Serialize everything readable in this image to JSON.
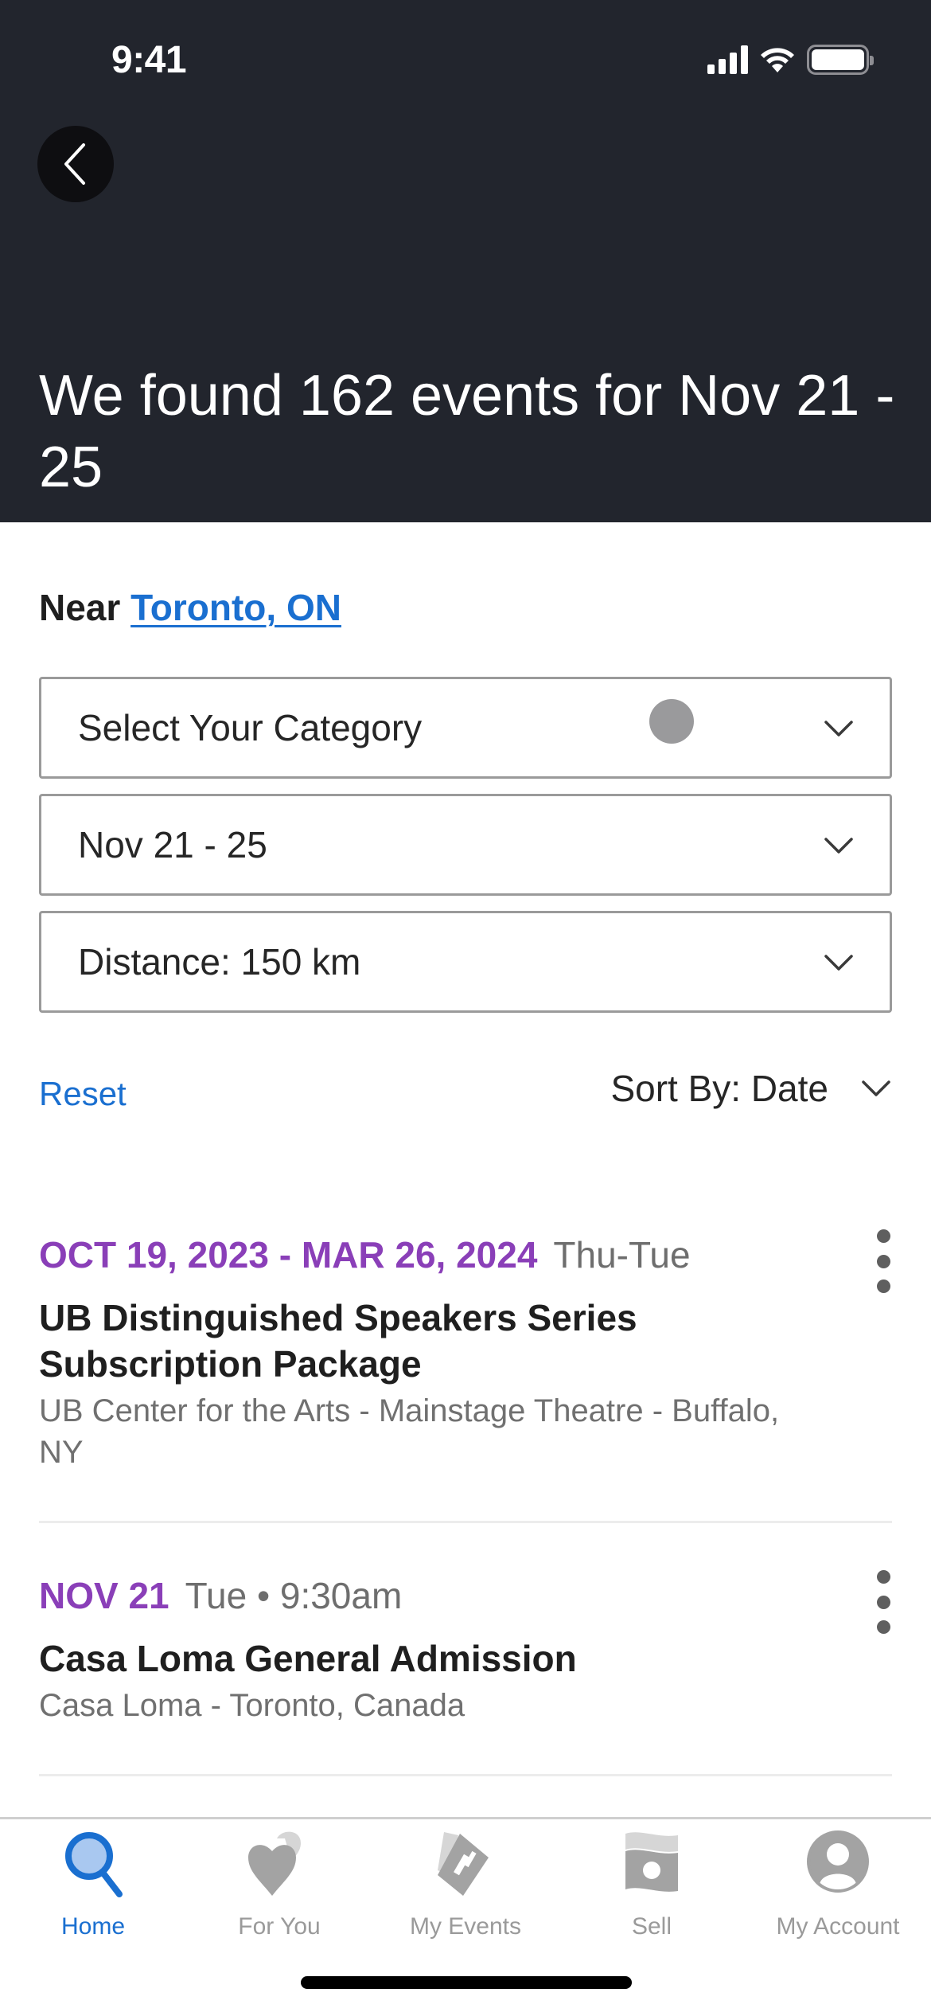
{
  "status_bar": {
    "time": "9:41"
  },
  "header": {
    "back_label": "Back",
    "title": "We found 162 events for Nov 21 - 25"
  },
  "location": {
    "prefix": "Near",
    "city": "Toronto, ON"
  },
  "filters": {
    "category": "Select Your Category",
    "dates": "Nov 21 - 25",
    "distance": "Distance: 150 km"
  },
  "controls": {
    "reset_label": "Reset",
    "sort_label": "Sort By: Date"
  },
  "events": [
    {
      "date": "OCT 19, 2023 - MAR 26, 2024",
      "when": "Thu-Tue",
      "title": "UB Distinguished Speakers Series Subscription Package",
      "venue": "UB Center for the Arts - Mainstage Theatre - Buffalo, NY"
    },
    {
      "date": "NOV 21",
      "when": "Tue • 9:30am",
      "title": "Casa Loma General Admission",
      "venue": "Casa Loma - Toronto, Canada"
    }
  ],
  "tabbar": {
    "items": [
      {
        "label": "Home",
        "icon": "search-icon",
        "active": true
      },
      {
        "label": "For You",
        "icon": "heart-icon",
        "active": false
      },
      {
        "label": "My Events",
        "icon": "ticket-icon",
        "active": false
      },
      {
        "label": "Sell",
        "icon": "cash-icon",
        "active": false
      },
      {
        "label": "My Account",
        "icon": "account-icon",
        "active": false
      }
    ]
  },
  "colors": {
    "header_bg": "#22252d",
    "accent_blue": "#1a6fd0",
    "date_purple": "#8a3fb8",
    "inactive_gray": "#9a9a9a"
  }
}
